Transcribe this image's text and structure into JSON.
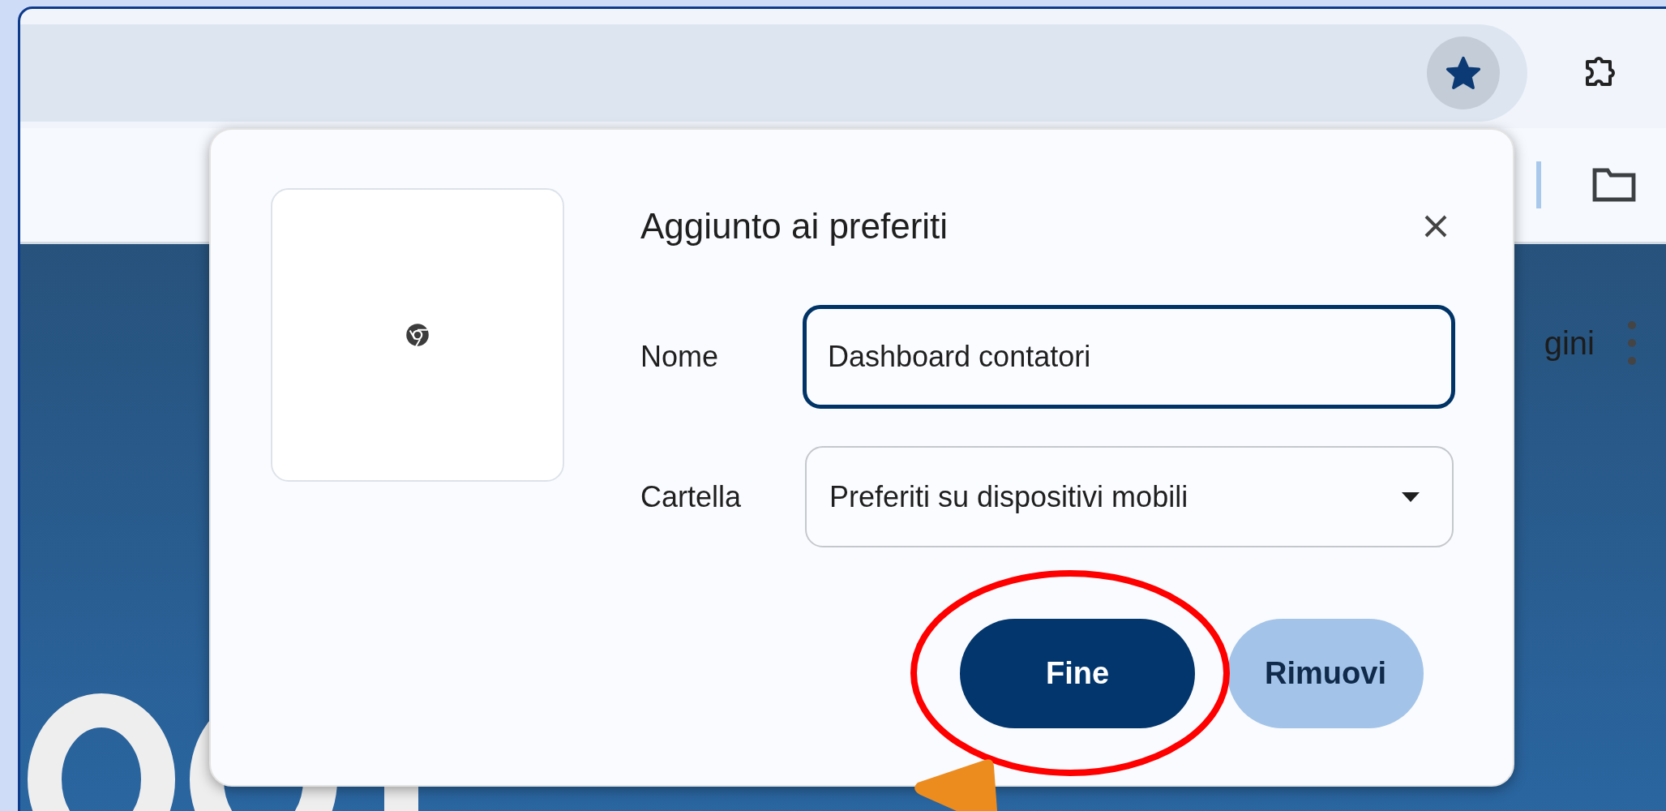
{
  "toolbar": {
    "bookmarked": true
  },
  "page": {
    "nav_text": "gini"
  },
  "dialog": {
    "title": "Aggiunto ai preferiti",
    "name_field": {
      "label": "Nome",
      "value": "Dashboard contatori",
      "focused": true
    },
    "folder_field": {
      "label": "Cartella",
      "value": "Preferiti su dispositivi mobili"
    },
    "buttons": [
      {
        "label": "Fine",
        "primary": true
      },
      {
        "label": "Rimuovi",
        "primary": false
      }
    ]
  }
}
